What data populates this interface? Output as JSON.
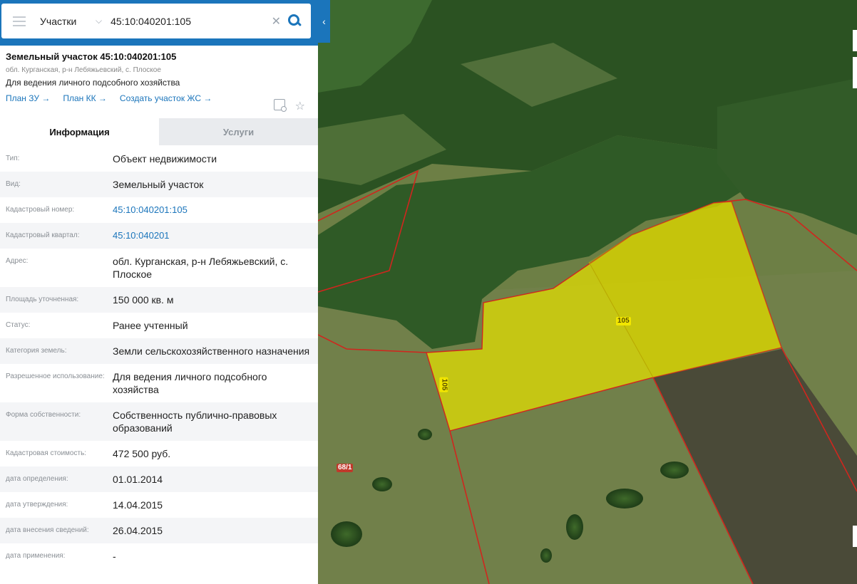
{
  "search": {
    "type_label": "Участки",
    "value": "45:10:040201:105"
  },
  "header": {
    "title": "Земельный участок 45:10:040201:105",
    "address": "обл. Курганская, р-н Лебяжьевский, с. Плоское",
    "purpose": "Для ведения личного подсобного хозяйства",
    "links": [
      "План ЗУ →",
      "План КК →",
      "Создать участок ЖС →"
    ]
  },
  "tabs": [
    {
      "label": "Информация",
      "active": true
    },
    {
      "label": "Услуги",
      "active": false
    }
  ],
  "info": [
    {
      "key": "Тип:",
      "value": "Объект недвижимости"
    },
    {
      "key": "Вид:",
      "value": "Земельный участок"
    },
    {
      "key": "Кадастровый номер:",
      "value": "45:10:040201:105",
      "link": true
    },
    {
      "key": "Кадастровый квартал:",
      "value": "45:10:040201",
      "link": true
    },
    {
      "key": "Адрес:",
      "value": "обл. Курганская, р-н Лебяжьевский, с. Плоское"
    },
    {
      "key": "Площадь уточненная:",
      "value": "150 000 кв. м"
    },
    {
      "key": "Статус:",
      "value": "Ранее учтенный"
    },
    {
      "key": "Категория земель:",
      "value": "Земли сельскохозяйственного назначения"
    },
    {
      "key": "Разрешенное использование:",
      "value": "Для ведения личного подсобного хозяйства"
    },
    {
      "key": "Форма собственности:",
      "value": "Собственность публично-правовых образований"
    },
    {
      "key": "Кадастровая стоимость:",
      "value": "472 500 руб."
    },
    {
      "key": "дата определения:",
      "value": "01.01.2014"
    },
    {
      "key": "дата утверждения:",
      "value": "14.04.2015"
    },
    {
      "key": "дата внесения сведений:",
      "value": "26.04.2015"
    },
    {
      "key": "дата применения:",
      "value": "-"
    }
  ],
  "map": {
    "parcel_labels": [
      "105",
      "105",
      "68/1"
    ]
  },
  "colors": {
    "accent": "#1b75bb",
    "parcel_fill": "#e6e000",
    "boundary": "#d0261e"
  }
}
